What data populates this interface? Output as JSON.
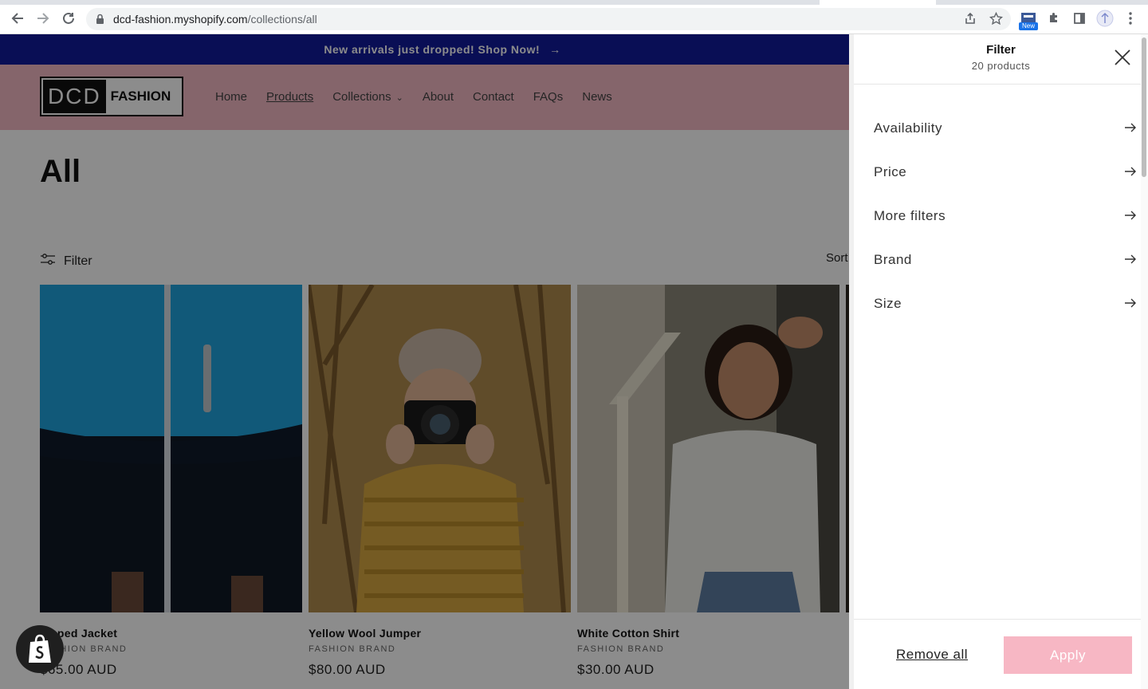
{
  "browser": {
    "url_domain": "dcd-fashion.myshopify.com",
    "url_path": "/collections/all",
    "ext_badge": "New"
  },
  "announcement": {
    "text": "New arrivals just dropped! Shop Now!",
    "arrow": "→"
  },
  "header": {
    "logo_dcd": "DCD",
    "logo_fashion": "FASHION",
    "nav": [
      "Home",
      "Products",
      "Collections",
      "About",
      "Contact",
      "FAQs",
      "News"
    ],
    "active": "Products",
    "collections_chevron": "⌄"
  },
  "main": {
    "title": "All",
    "filter_label": "Filter",
    "sort_label": "Sort"
  },
  "products": [
    {
      "name": "Zipped Jacket",
      "brand": "FASHION BRAND",
      "price": "$65.00 AUD"
    },
    {
      "name": "Yellow Wool Jumper",
      "brand": "FASHION BRAND",
      "price": "$80.00 AUD"
    },
    {
      "name": "White Cotton Shirt",
      "brand": "FASHION BRAND",
      "price": "$30.00 AUD"
    }
  ],
  "drawer": {
    "title": "Filter",
    "count": "20 products",
    "filters": [
      "Availability",
      "Price",
      "More filters",
      "Brand",
      "Size"
    ],
    "remove_all": "Remove all",
    "apply": "Apply",
    "arrow": "→"
  },
  "colors": {
    "announce_bg": "#121a9c",
    "header_bg": "#f3b8c4",
    "apply_bg": "#f7b7c4"
  }
}
